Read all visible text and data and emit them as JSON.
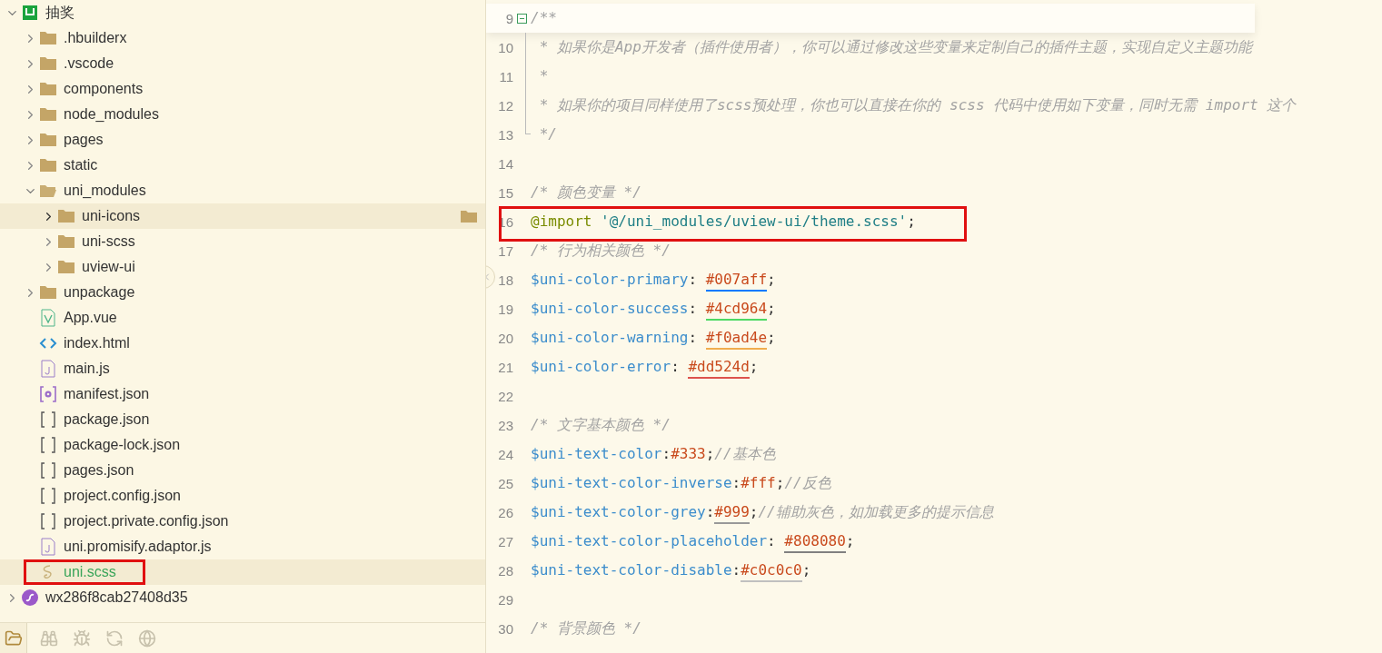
{
  "explorer": {
    "tree": [
      {
        "label": "抽奖",
        "kind": "project",
        "expanded": true,
        "selected": false,
        "hovered": false,
        "boxed": false,
        "children": [
          {
            "label": ".hbuilderx",
            "kind": "folder",
            "expanded": false,
            "selected": false,
            "hovered": false,
            "boxed": false
          },
          {
            "label": ".vscode",
            "kind": "folder",
            "expanded": false,
            "selected": false,
            "hovered": false,
            "boxed": false
          },
          {
            "label": "components",
            "kind": "folder",
            "expanded": false,
            "selected": false,
            "hovered": false,
            "boxed": false
          },
          {
            "label": "node_modules",
            "kind": "folder",
            "expanded": false,
            "selected": false,
            "hovered": false,
            "boxed": false
          },
          {
            "label": "pages",
            "kind": "folder",
            "expanded": false,
            "selected": false,
            "hovered": false,
            "boxed": false
          },
          {
            "label": "static",
            "kind": "folder",
            "expanded": false,
            "selected": false,
            "hovered": false,
            "boxed": false
          },
          {
            "label": "uni_modules",
            "kind": "folder",
            "expanded": true,
            "selected": false,
            "hovered": false,
            "boxed": false,
            "children": [
              {
                "label": "uni-icons",
                "kind": "folder",
                "expanded": false,
                "selected": false,
                "hovered": true,
                "boxed": false
              },
              {
                "label": "uni-scss",
                "kind": "folder",
                "expanded": false,
                "selected": false,
                "hovered": false,
                "boxed": false
              },
              {
                "label": "uview-ui",
                "kind": "folder",
                "expanded": false,
                "selected": false,
                "hovered": false,
                "boxed": false
              }
            ]
          },
          {
            "label": "unpackage",
            "kind": "folder",
            "expanded": false,
            "selected": false,
            "hovered": false,
            "boxed": false
          },
          {
            "label": "App.vue",
            "kind": "vue",
            "selected": false,
            "hovered": false,
            "boxed": false
          },
          {
            "label": "index.html",
            "kind": "html",
            "selected": false,
            "hovered": false,
            "boxed": false
          },
          {
            "label": "main.js",
            "kind": "js",
            "selected": false,
            "hovered": false,
            "boxed": false
          },
          {
            "label": "manifest.json",
            "kind": "manifest",
            "selected": false,
            "hovered": false,
            "boxed": false
          },
          {
            "label": "package.json",
            "kind": "json",
            "selected": false,
            "hovered": false,
            "boxed": false
          },
          {
            "label": "package-lock.json",
            "kind": "json",
            "selected": false,
            "hovered": false,
            "boxed": false
          },
          {
            "label": "pages.json",
            "kind": "json",
            "selected": false,
            "hovered": false,
            "boxed": false
          },
          {
            "label": "project.config.json",
            "kind": "json",
            "selected": false,
            "hovered": false,
            "boxed": false
          },
          {
            "label": "project.private.config.json",
            "kind": "json",
            "selected": false,
            "hovered": false,
            "boxed": false
          },
          {
            "label": "uni.promisify.adaptor.js",
            "kind": "js",
            "selected": false,
            "hovered": false,
            "boxed": false
          },
          {
            "label": "uni.scss",
            "kind": "scss",
            "selected": true,
            "hovered": false,
            "boxed": true
          }
        ]
      },
      {
        "label": "wx286f8cab27408d35",
        "kind": "miniprogram",
        "expanded": false,
        "selected": false,
        "hovered": false,
        "boxed": false
      }
    ],
    "toolbar": [
      {
        "kind": "files",
        "selected": true
      },
      {
        "kind": "search",
        "selected": false
      },
      {
        "kind": "debug",
        "selected": false
      },
      {
        "kind": "sync",
        "selected": false
      },
      {
        "kind": "plugins",
        "selected": false
      }
    ]
  },
  "editor": {
    "lines": [
      {
        "number": "9",
        "fold_open": true,
        "boxed": false,
        "tokens": [
          {
            "kind": "comment",
            "text": "/**"
          }
        ]
      },
      {
        "number": "10",
        "fold_guide": true,
        "boxed": false,
        "tokens": [
          {
            "kind": "comment",
            "text": " * 如果你是App开发者（插件使用者），你可以通过修改这些变量来定制自己的插件主题，实现自定义主题功能"
          }
        ]
      },
      {
        "number": "11",
        "fold_guide": true,
        "boxed": false,
        "tokens": [
          {
            "kind": "comment",
            "text": " *"
          }
        ]
      },
      {
        "number": "12",
        "fold_guide": true,
        "boxed": false,
        "tokens": [
          {
            "kind": "comment",
            "text": " * 如果你的项目同样使用了scss预处理，你也可以直接在你的 scss 代码中使用如下变量，同时无需 import 这个"
          }
        ]
      },
      {
        "number": "13",
        "fold_end": true,
        "boxed": false,
        "tokens": [
          {
            "kind": "comment",
            "text": " */"
          }
        ]
      },
      {
        "number": "14",
        "boxed": false
      },
      {
        "number": "15",
        "boxed": false,
        "tokens": [
          {
            "kind": "comment",
            "text": "/* 颜色变量 */"
          }
        ]
      },
      {
        "number": "16",
        "boxed": true,
        "tokens": [
          {
            "kind": "keyword",
            "text": "@import"
          },
          {
            "kind": "string",
            "text": " '@/uni_modules/uview-ui/theme.scss'"
          },
          {
            "kind": "punct",
            "text": ";"
          }
        ]
      },
      {
        "number": "17",
        "boxed": false,
        "tokens": [
          {
            "kind": "comment",
            "text": "/* 行为相关颜色 */"
          }
        ]
      },
      {
        "number": "18",
        "boxed": false,
        "tokens": [
          {
            "kind": "variable",
            "text": "$uni-color-primary"
          },
          {
            "kind": "punct",
            "text": ": "
          },
          {
            "kind": "value",
            "text": "#007aff",
            "color": "#007aff"
          },
          {
            "kind": "punct",
            "text": ";"
          }
        ]
      },
      {
        "number": "19",
        "boxed": false,
        "tokens": [
          {
            "kind": "variable",
            "text": "$uni-color-success"
          },
          {
            "kind": "punct",
            "text": ": "
          },
          {
            "kind": "value",
            "text": "#4cd964",
            "color": "#4cd964"
          },
          {
            "kind": "punct",
            "text": ";"
          }
        ]
      },
      {
        "number": "20",
        "boxed": false,
        "tokens": [
          {
            "kind": "variable",
            "text": "$uni-color-warning"
          },
          {
            "kind": "punct",
            "text": ": "
          },
          {
            "kind": "value",
            "text": "#f0ad4e",
            "color": "#f0ad4e"
          },
          {
            "kind": "punct",
            "text": ";"
          }
        ]
      },
      {
        "number": "21",
        "boxed": false,
        "tokens": [
          {
            "kind": "variable",
            "text": "$uni-color-error"
          },
          {
            "kind": "punct",
            "text": ": "
          },
          {
            "kind": "value",
            "text": "#dd524d",
            "color": "#dd524d"
          },
          {
            "kind": "punct",
            "text": ";"
          }
        ]
      },
      {
        "number": "22",
        "boxed": false
      },
      {
        "number": "23",
        "boxed": false,
        "tokens": [
          {
            "kind": "comment",
            "text": "/* 文字基本颜色 */"
          }
        ]
      },
      {
        "number": "24",
        "boxed": false,
        "tokens": [
          {
            "kind": "variable",
            "text": "$uni-text-color"
          },
          {
            "kind": "punct",
            "text": ":"
          },
          {
            "kind": "value",
            "text": "#333"
          },
          {
            "kind": "punct",
            "text": ";"
          },
          {
            "kind": "comment",
            "text": "//基本色"
          }
        ]
      },
      {
        "number": "25",
        "boxed": false,
        "tokens": [
          {
            "kind": "variable",
            "text": "$uni-text-color-inverse"
          },
          {
            "kind": "punct",
            "text": ":"
          },
          {
            "kind": "value",
            "text": "#fff"
          },
          {
            "kind": "punct",
            "text": ";"
          },
          {
            "kind": "comment",
            "text": "//反色"
          }
        ]
      },
      {
        "number": "26",
        "boxed": false,
        "tokens": [
          {
            "kind": "variable",
            "text": "$uni-text-color-grey"
          },
          {
            "kind": "punct",
            "text": ":"
          },
          {
            "kind": "value",
            "text": "#999",
            "color": "#999999"
          },
          {
            "kind": "punct",
            "text": ";"
          },
          {
            "kind": "comment",
            "text": "//辅助灰色，如加载更多的提示信息"
          }
        ]
      },
      {
        "number": "27",
        "boxed": false,
        "tokens": [
          {
            "kind": "variable",
            "text": "$uni-text-color-placeholder"
          },
          {
            "kind": "punct",
            "text": ": "
          },
          {
            "kind": "value",
            "text": "#808080",
            "color": "#808080"
          },
          {
            "kind": "punct",
            "text": ";"
          }
        ]
      },
      {
        "number": "28",
        "boxed": false,
        "tokens": [
          {
            "kind": "variable",
            "text": "$uni-text-color-disable"
          },
          {
            "kind": "punct",
            "text": ":"
          },
          {
            "kind": "value",
            "text": "#c0c0c0",
            "color": "#c0c0c0"
          },
          {
            "kind": "punct",
            "text": ";"
          }
        ]
      },
      {
        "number": "29",
        "boxed": false
      },
      {
        "number": "30",
        "boxed": false,
        "tokens": [
          {
            "kind": "comment",
            "text": "/* 背景颜色 */"
          }
        ]
      }
    ]
  }
}
